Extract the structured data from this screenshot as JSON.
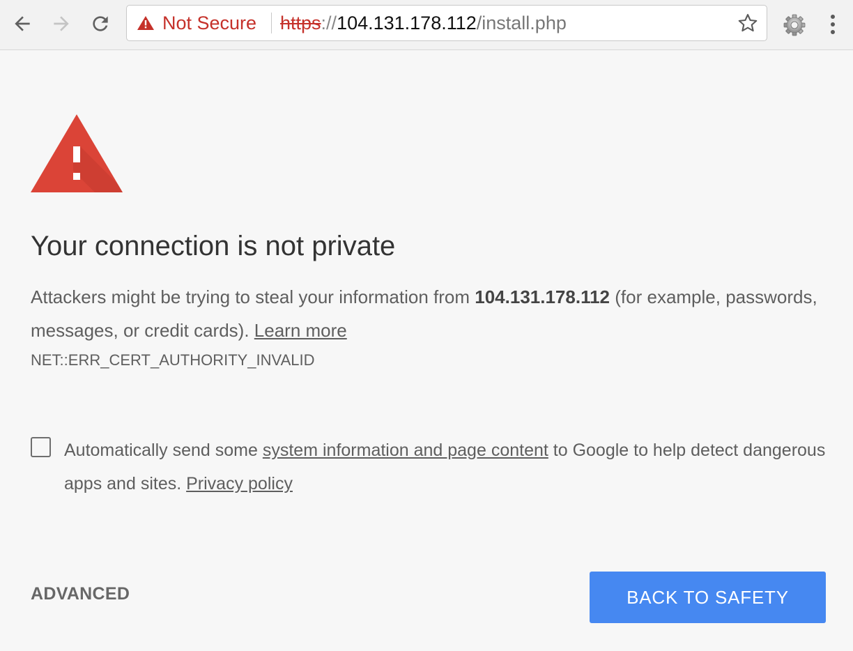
{
  "browser": {
    "nav": {
      "back_icon": "arrow-left-icon",
      "forward_icon": "arrow-right-icon",
      "reload_icon": "reload-icon"
    },
    "omnibox": {
      "security_icon": "warning-triangle-icon",
      "security_label": "Not Secure",
      "url_scheme": "https",
      "url_separator": "://",
      "url_host": "104.131.178.112",
      "url_path": "/install.php",
      "bookmark_icon": "star-icon"
    },
    "extension_icon": "gear-icon",
    "menu_icon": "more-vert-icon"
  },
  "interstitial": {
    "icon": "red-warning-triangle-icon",
    "heading": "Your connection is not private",
    "explanation": {
      "prefix": "Attackers might be trying to steal your information from ",
      "host": "104.131.178.112",
      "suffix": " (for example, passwords, messages, or credit cards). ",
      "learn_more": "Learn more"
    },
    "error_code": "NET::ERR_CERT_AUTHORITY_INVALID",
    "opt_in": {
      "checked": false,
      "prefix": "Automatically send some ",
      "link": "system information and page content",
      "middle": " to Google to help detect dangerous apps and sites. ",
      "privacy_link": "Privacy policy"
    },
    "advanced_label": "ADVANCED",
    "back_to_safety_label": "BACK TO SAFETY"
  },
  "colors": {
    "danger": "#c5312a",
    "alert_red": "#db4437",
    "primary_button": "#4688f1",
    "background": "#f7f7f7"
  }
}
